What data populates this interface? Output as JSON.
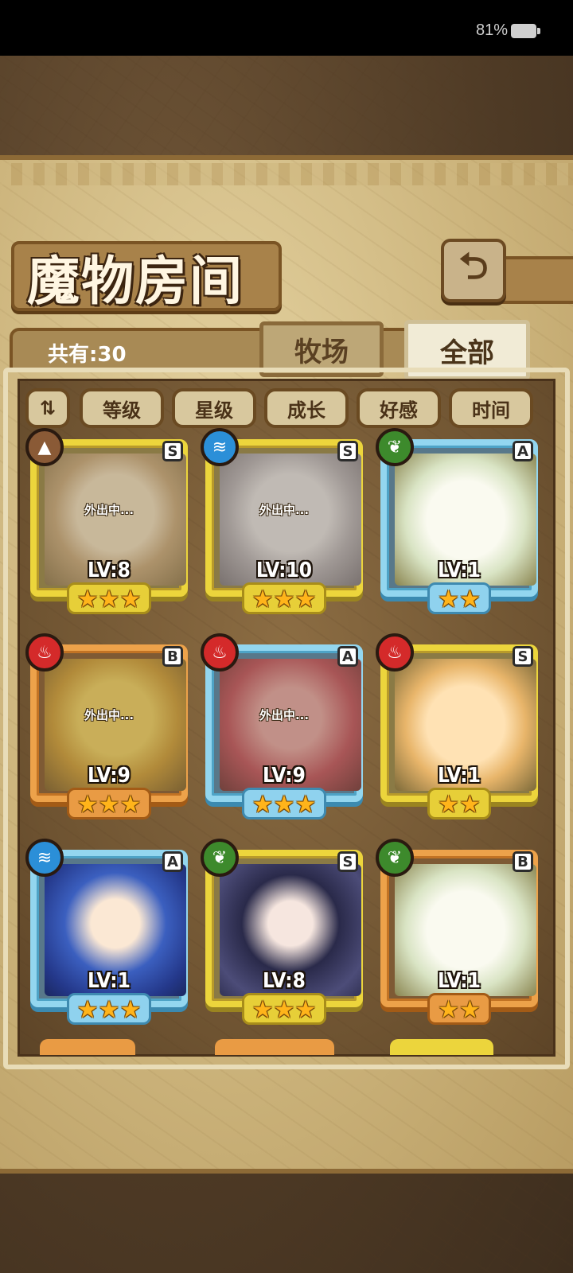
{
  "status_bar": {
    "battery_percent": "81%",
    "battery_icon": "battery-icon"
  },
  "header": {
    "title": "魔物房间",
    "back_icon": "back-arrow-icon",
    "back_glyph": "⮌"
  },
  "summary": {
    "count_label": "共有:30"
  },
  "tabs": [
    {
      "label": "牧场",
      "selected": false
    },
    {
      "label": "全部",
      "selected": true
    }
  ],
  "sort": {
    "toggle_icon": "sort-order-icon",
    "toggle_glyph": "⇅",
    "buttons": [
      "等级",
      "星级",
      "成长",
      "好感",
      "时间"
    ]
  },
  "monsters": [
    {
      "rank": "S",
      "element": "earth",
      "element_glyph": "▲",
      "level": "LV:8",
      "stars": 3,
      "status": "外出中...",
      "frame": "gold",
      "portrait": "p-tan"
    },
    {
      "rank": "S",
      "element": "water",
      "element_glyph": "≋",
      "level": "LV:10",
      "stars": 3,
      "status": "外出中...",
      "frame": "gold",
      "portrait": "p-grey"
    },
    {
      "rank": "A",
      "element": "wood",
      "element_glyph": "❦",
      "level": "LV:1",
      "stars": 2,
      "status": "",
      "frame": "blue",
      "portrait": "p-white"
    },
    {
      "rank": "B",
      "element": "fire",
      "element_glyph": "♨",
      "level": "LV:9",
      "stars": 3,
      "status": "外出中...",
      "frame": "orange",
      "portrait": "p-yellow"
    },
    {
      "rank": "A",
      "element": "fire",
      "element_glyph": "♨",
      "level": "LV:9",
      "stars": 3,
      "status": "外出中...",
      "frame": "blue",
      "portrait": "p-red"
    },
    {
      "rank": "S",
      "element": "fire",
      "element_glyph": "♨",
      "level": "LV:1",
      "stars": 2,
      "status": "",
      "frame": "gold",
      "portrait": "p-pudding"
    },
    {
      "rank": "A",
      "element": "water",
      "element_glyph": "≋",
      "level": "LV:1",
      "stars": 3,
      "status": "",
      "frame": "blue",
      "portrait": "p-bluehair"
    },
    {
      "rank": "S",
      "element": "wood",
      "element_glyph": "❦",
      "level": "LV:8",
      "stars": 3,
      "status": "",
      "frame": "gold",
      "portrait": "p-black"
    },
    {
      "rank": "B",
      "element": "wood",
      "element_glyph": "❦",
      "level": "LV:1",
      "stars": 2,
      "status": "",
      "frame": "orange",
      "portrait": "p-white"
    }
  ],
  "colors": {
    "gold_frame": "#ecd53c",
    "blue_frame": "#93d6ef",
    "orange_frame": "#eda24a",
    "star": "#ffb41a"
  }
}
